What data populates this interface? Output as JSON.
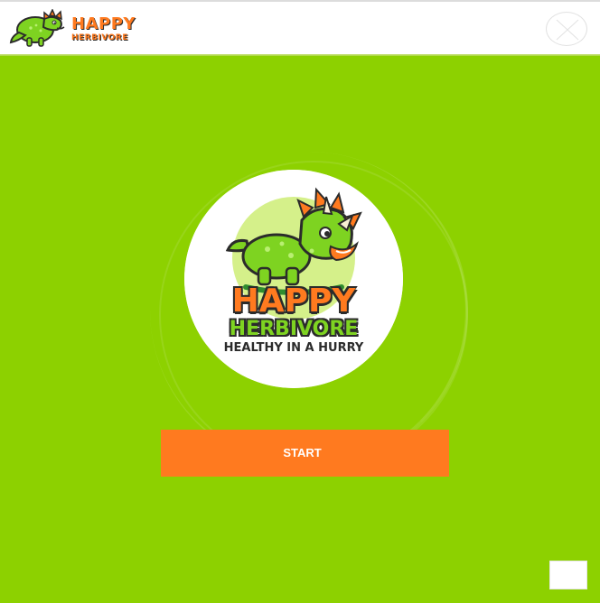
{
  "app": {
    "brand": {
      "top": "HAPPY",
      "bottom": "HERBIVORE"
    }
  },
  "icons": {
    "header_logo": "dinosaur-logo-icon",
    "close": "close-icon",
    "hero_logo": "dinosaur-badge-icon",
    "chat": "chat-widget-icon"
  },
  "hero": {
    "title": "HAPPY",
    "subtitle": "HERBIVORE",
    "tagline": "HEALTHY IN A HURRY"
  },
  "actions": {
    "start_label": "START"
  },
  "colors": {
    "page_bg": "#ffffff",
    "main_bg": "#8dd100",
    "accent": "#ff7a1f",
    "button_text": "#ffffff",
    "dark_outline": "#2b2b2b",
    "dino_green": "#7ed321"
  }
}
